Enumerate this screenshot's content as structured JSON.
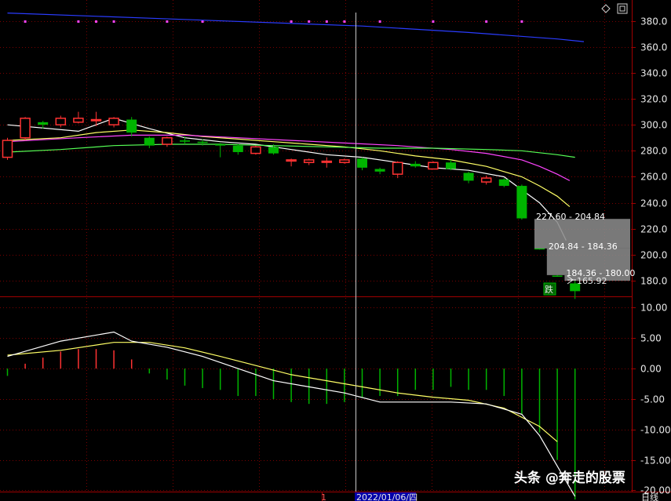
{
  "colors": {
    "background": "#000000",
    "up": "#ff3232",
    "down": "#00b400",
    "grid": "#7a0000",
    "axis": "#a00000",
    "ma_white": "#ffffff",
    "ma_yellow": "#ffff66",
    "ma_magenta": "#ff44ff",
    "ma_green": "#55ff55",
    "ma_blue": "#2a3cff",
    "cursor": "#c8c8c8"
  },
  "chart_data": [
    {
      "type": "candlestick",
      "yticks": [
        "380.0",
        "360.0",
        "340.0",
        "320.0",
        "300.0",
        "280.0",
        "260.0",
        "240.0",
        "220.0",
        "200.0",
        "180.0"
      ],
      "ylim": [
        168,
        396
      ],
      "candles": [
        {
          "o": 275,
          "c": 288,
          "h": 290,
          "l": 273
        },
        {
          "o": 290,
          "c": 305,
          "h": 306,
          "l": 288
        },
        {
          "o": 302,
          "c": 300,
          "h": 303,
          "l": 297
        },
        {
          "o": 300,
          "c": 305,
          "h": 307,
          "l": 298
        },
        {
          "o": 302,
          "c": 305,
          "h": 310,
          "l": 301
        },
        {
          "o": 304,
          "c": 304,
          "h": 310,
          "l": 299
        },
        {
          "o": 300,
          "c": 305,
          "h": 306,
          "l": 298
        },
        {
          "o": 304,
          "c": 294,
          "h": 306,
          "l": 291
        },
        {
          "o": 290,
          "c": 284,
          "h": 291,
          "l": 282
        },
        {
          "o": 285,
          "c": 290,
          "h": 291,
          "l": 283
        },
        {
          "o": 288,
          "c": 287,
          "h": 291,
          "l": 285
        },
        {
          "o": 287,
          "c": 286,
          "h": 289,
          "l": 284
        },
        {
          "o": 285,
          "c": 284,
          "h": 286,
          "l": 275
        },
        {
          "o": 284,
          "c": 279,
          "h": 285,
          "l": 277
        },
        {
          "o": 278,
          "c": 283,
          "h": 284,
          "l": 277
        },
        {
          "o": 283,
          "c": 278,
          "h": 285,
          "l": 277
        },
        {
          "o": 273,
          "c": 273,
          "h": 274,
          "l": 268
        },
        {
          "o": 271,
          "c": 273,
          "h": 274,
          "l": 269
        },
        {
          "o": 272,
          "c": 272,
          "h": 275,
          "l": 267
        },
        {
          "o": 271,
          "c": 273,
          "h": 274,
          "l": 270
        },
        {
          "o": 274,
          "c": 267,
          "h": 275,
          "l": 265
        },
        {
          "o": 266,
          "c": 264,
          "h": 267,
          "l": 262
        },
        {
          "o": 262,
          "c": 271,
          "h": 272,
          "l": 259
        },
        {
          "o": 270,
          "c": 268,
          "h": 272,
          "l": 267
        },
        {
          "o": 266,
          "c": 271,
          "h": 272,
          "l": 266
        },
        {
          "o": 271,
          "c": 266,
          "h": 273,
          "l": 265
        },
        {
          "o": 263,
          "c": 257,
          "h": 264,
          "l": 255
        },
        {
          "o": 256,
          "c": 259,
          "h": 261,
          "l": 254
        },
        {
          "o": 258,
          "c": 253,
          "h": 259,
          "l": 252
        },
        {
          "o": 253,
          "c": 228,
          "h": 254,
          "l": 227
        },
        {
          "o": 205,
          "c": 204.5,
          "h": 205,
          "l": 204
        },
        {
          "o": 184,
          "c": 183.5,
          "h": 184.4,
          "l": 183
        },
        {
          "o": 178,
          "c": 172,
          "h": 181,
          "l": 166
        }
      ],
      "ma": [
        {
          "color": "ma_white",
          "points": [
            [
              0,
              300
            ],
            [
              4,
              295
            ],
            [
              6,
              305
            ],
            [
              8,
              297
            ],
            [
              10,
              290
            ],
            [
              12,
              287
            ],
            [
              14,
              285
            ],
            [
              16,
              281
            ],
            [
              18,
              277
            ],
            [
              20,
              275
            ],
            [
              22,
              271
            ],
            [
              24,
              267
            ],
            [
              26,
              265
            ],
            [
              28,
              260
            ],
            [
              29,
              250
            ],
            [
              30,
              240
            ],
            [
              31,
              225
            ],
            [
              31.5,
              211
            ]
          ]
        },
        {
          "color": "ma_yellow",
          "points": [
            [
              0,
              288
            ],
            [
              3,
              290
            ],
            [
              5,
              294
            ],
            [
              7,
              296
            ],
            [
              9,
              294
            ],
            [
              11,
              291
            ],
            [
              13,
              289
            ],
            [
              15,
              287
            ],
            [
              17,
              285
            ],
            [
              19,
              283
            ],
            [
              21,
              280
            ],
            [
              23,
              276
            ],
            [
              25,
              273
            ],
            [
              27,
              268
            ],
            [
              29,
              260
            ],
            [
              30,
              253
            ],
            [
              31,
              245
            ],
            [
              31.7,
              237
            ]
          ]
        },
        {
          "color": "ma_magenta",
          "points": [
            [
              0,
              287
            ],
            [
              4,
              290
            ],
            [
              7,
              292
            ],
            [
              10,
              292
            ],
            [
              13,
              290
            ],
            [
              16,
              288
            ],
            [
              19,
              286
            ],
            [
              22,
              284
            ],
            [
              25,
              281
            ],
            [
              27,
              278
            ],
            [
              29,
              273
            ],
            [
              30,
              268
            ],
            [
              31,
              262
            ],
            [
              31.7,
              257
            ]
          ]
        },
        {
          "color": "ma_green",
          "points": [
            [
              0,
              279
            ],
            [
              3,
              281
            ],
            [
              6,
              284
            ],
            [
              9,
              285
            ],
            [
              12,
              285
            ],
            [
              15,
              284
            ],
            [
              18,
              283
            ],
            [
              21,
              282
            ],
            [
              24,
              282
            ],
            [
              27,
              281
            ],
            [
              29,
              280
            ],
            [
              31,
              277
            ],
            [
              32,
              275
            ]
          ]
        },
        {
          "color": "ma_blue",
          "points": [
            [
              0,
              386
            ],
            [
              8,
              382
            ],
            [
              20,
              376
            ],
            [
              26,
              371
            ],
            [
              31,
              366
            ],
            [
              32.5,
              364
            ]
          ]
        }
      ],
      "ranges": [
        {
          "label": "227.60 - 204.84",
          "low": 204.84,
          "high": 227.6,
          "from": 30
        },
        {
          "label": "204.84 - 184.36",
          "low": 184.36,
          "high": 204.84,
          "from": 30.7
        },
        {
          "label": "184.36 - 180.00",
          "low": 180.0,
          "high": 184.36,
          "from": 31.7
        }
      ],
      "low_label": "165.92",
      "low_value": 165.92,
      "signal_text": "跌",
      "markers": [
        1,
        4,
        5,
        6,
        9,
        11,
        16,
        17,
        18,
        19,
        21,
        24,
        27,
        29
      ]
    },
    {
      "type": "macd",
      "yticks": [
        "10.00",
        "5.00",
        "0.00",
        "-5.00",
        "-10.00",
        "-15.00",
        "-20.00"
      ],
      "ylim": [
        -20.2,
        11.6
      ],
      "hist": [
        -1.2,
        0.8,
        1.8,
        2.8,
        3.2,
        3.2,
        3.0,
        1.5,
        -0.8,
        -1.8,
        -2.8,
        -3.2,
        -3.5,
        -4.5,
        -4.5,
        -5.0,
        -5.5,
        -5.8,
        -5.8,
        -5.5,
        -4.8,
        -4.5,
        -4.5,
        -3.5,
        -3.5,
        -3.0,
        -3.5,
        -3.5,
        -4.5,
        -7.5,
        -10.5,
        -15.0,
        -21.5
      ],
      "dif": [
        [
          0,
          2.0
        ],
        [
          3,
          4.5
        ],
        [
          6,
          6.0
        ],
        [
          7,
          4.5
        ],
        [
          9,
          3.5
        ],
        [
          11,
          2.0
        ],
        [
          13,
          0.0
        ],
        [
          15,
          -2.0
        ],
        [
          17,
          -3.0
        ],
        [
          19,
          -4.0
        ],
        [
          21,
          -5.5
        ],
        [
          23,
          -5.5
        ],
        [
          25,
          -5.5
        ],
        [
          27,
          -5.8
        ],
        [
          29,
          -7.5
        ],
        [
          30,
          -11.0
        ],
        [
          31,
          -16.0
        ],
        [
          32,
          -21.0
        ]
      ],
      "dea": [
        [
          0,
          2.2
        ],
        [
          3,
          3.0
        ],
        [
          6,
          4.3
        ],
        [
          8,
          4.3
        ],
        [
          10,
          3.4
        ],
        [
          12,
          2.0
        ],
        [
          14,
          0.5
        ],
        [
          16,
          -1.0
        ],
        [
          18,
          -2.0
        ],
        [
          20,
          -3.0
        ],
        [
          22,
          -4.0
        ],
        [
          24,
          -4.7
        ],
        [
          26,
          -5.2
        ],
        [
          28,
          -6.5
        ],
        [
          30,
          -9.5
        ],
        [
          31,
          -12.0
        ]
      ]
    }
  ],
  "axis_bottom": {
    "marker": "1",
    "date_label": "2022/01/06/四",
    "period_label": "日线"
  },
  "watermark": "头条 @奔走的股票"
}
